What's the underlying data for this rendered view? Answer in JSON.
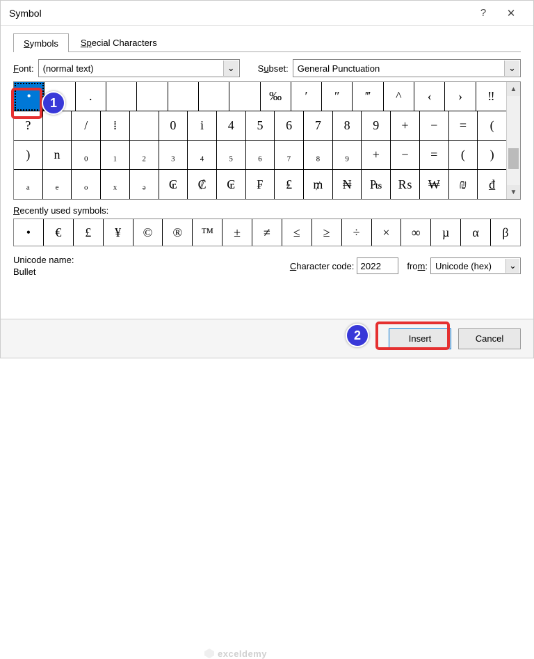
{
  "title": "Symbol",
  "tabs": {
    "symbols": "Symbols",
    "special": "Special Characters"
  },
  "font": {
    "label": "Font:",
    "value": "(normal text)"
  },
  "subset": {
    "label": "Subset:",
    "value": "General Punctuation"
  },
  "grid": [
    [
      "•",
      "",
      ".",
      "",
      "",
      "",
      "",
      "",
      "‰",
      "′",
      "″",
      "‴",
      "^",
      "‹",
      "›",
      "‼"
    ],
    [
      "?",
      "",
      "/",
      "⁞",
      "",
      "0",
      "i",
      "4",
      "5",
      "6",
      "7",
      "8",
      "9",
      "+",
      "−",
      "=",
      "("
    ],
    [
      ")",
      "n",
      "₀",
      "₁",
      "₂",
      "₃",
      "₄",
      "₅",
      "₆",
      "₇",
      "₈",
      "₉",
      "+",
      "−",
      "=",
      "(",
      ")"
    ],
    [
      "ₐ",
      "ₑ",
      "ₒ",
      "ₓ",
      "ₔ",
      "₢",
      "₡",
      "₢",
      "₣",
      "₤",
      "₥",
      "₦",
      "₧",
      "₨",
      "₩",
      "₪",
      "₫"
    ]
  ],
  "recent": {
    "label": "Recently used symbols:",
    "items": [
      "•",
      "€",
      "£",
      "¥",
      "©",
      "®",
      "™",
      "±",
      "≠",
      "≤",
      "≥",
      "÷",
      "×",
      "∞",
      "µ",
      "α",
      "β"
    ]
  },
  "unicode": {
    "name_label": "Unicode name:",
    "name_value": "Bullet",
    "code_label": "Character code:",
    "code_value": "2022",
    "from_label": "from:",
    "from_value": "Unicode (hex)"
  },
  "buttons": {
    "insert": "Insert",
    "cancel": "Cancel"
  },
  "annotations": {
    "b1": "1",
    "b2": "2"
  },
  "watermark": "exceldemy",
  "chevron": "⌄"
}
